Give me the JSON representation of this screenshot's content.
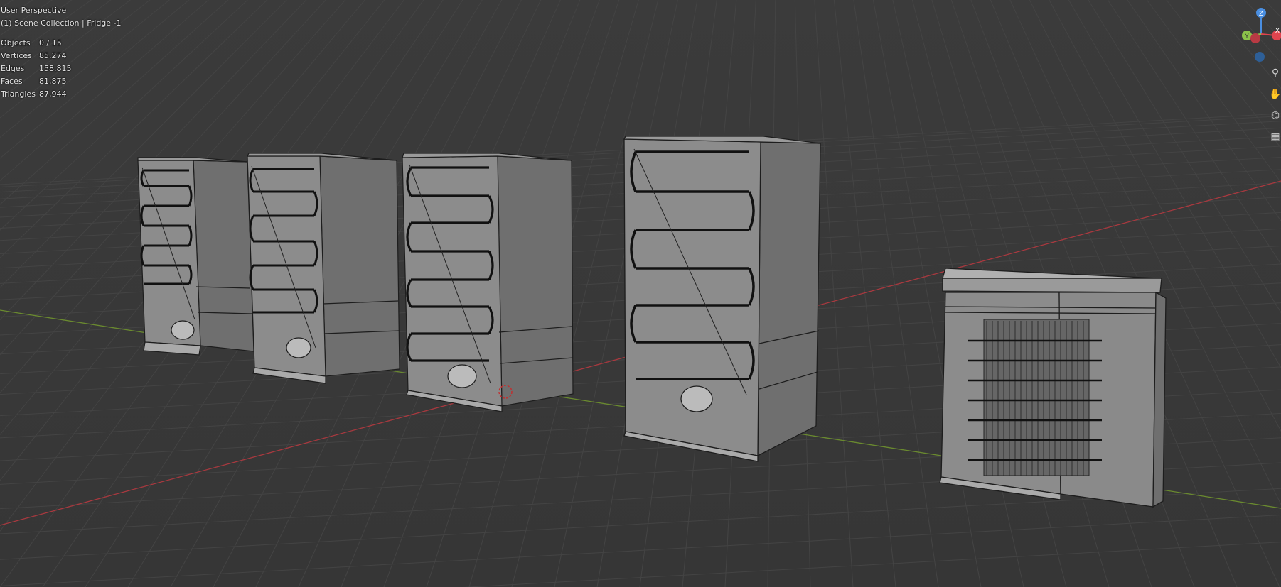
{
  "viewport": {
    "view_name": "User Perspective",
    "scene_info": "(1) Scene Collection | Fridge -1"
  },
  "stats": [
    {
      "label": "Objects",
      "value": "0 / 15"
    },
    {
      "label": "Vertices",
      "value": "85,274"
    },
    {
      "label": "Edges",
      "value": "158,815"
    },
    {
      "label": "Faces",
      "value": "81,875"
    },
    {
      "label": "Triangles",
      "value": "87,944"
    }
  ],
  "gizmo": {
    "z_label": "Z",
    "x_label": "X",
    "y_label": "Y",
    "colors": {
      "x": "#e0444e",
      "y": "#8bc34a",
      "z": "#4a8ee0"
    }
  },
  "tools": [
    {
      "name": "zoom-icon",
      "glyph": "⚲"
    },
    {
      "name": "pan-hand-icon",
      "glyph": "✋"
    },
    {
      "name": "camera-icon",
      "glyph": "⌬"
    },
    {
      "name": "grid-view-icon",
      "glyph": "▦"
    }
  ],
  "colors": {
    "background": "#393939",
    "grid_line": "#444444",
    "x_axis": "#a8393f",
    "y_axis": "#6a8a2f",
    "object_fill": "#7a7a7a",
    "object_wire": "#1a1a1a"
  }
}
